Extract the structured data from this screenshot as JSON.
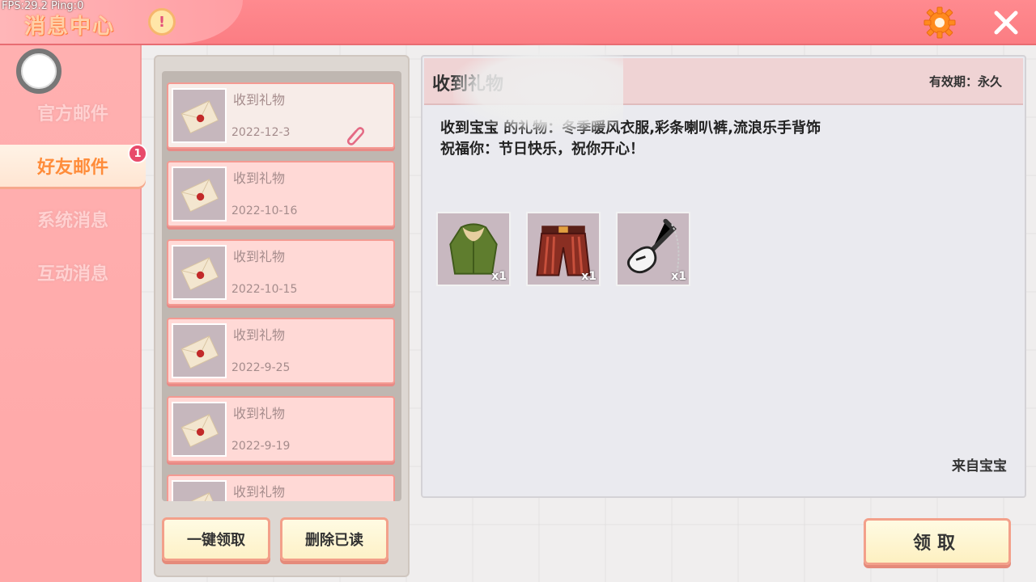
{
  "overlay": {
    "fps": "FPS:29.2  Ping:0"
  },
  "header": {
    "title": "消息中心",
    "alert_glyph": "!"
  },
  "sidebar": {
    "items": [
      {
        "label": "官方邮件"
      },
      {
        "label": "好友邮件",
        "badge": "1"
      },
      {
        "label": "系统消息"
      },
      {
        "label": "互动消息"
      }
    ]
  },
  "mail_list": {
    "items": [
      {
        "subject": "收到礼物",
        "date": "2022-12-3",
        "selected": true,
        "has_attachment": true
      },
      {
        "subject": "收到礼物",
        "date": "2022-10-16"
      },
      {
        "subject": "收到礼物",
        "date": "2022-10-15"
      },
      {
        "subject": "收到礼物",
        "date": "2022-9-25"
      },
      {
        "subject": "收到礼物",
        "date": "2022-9-19"
      },
      {
        "subject": "收到礼物",
        "date": ""
      }
    ],
    "claim_all_label": "一键领取",
    "delete_read_label": "删除已读"
  },
  "detail": {
    "title": "收到礼物",
    "validity": "有效期：永久",
    "body_line1": "收到宝宝                的礼物：冬季暖风衣服,彩条喇叭裤,流浪乐手背饰",
    "body_line2": "祝福你：节日快乐，祝你开心！",
    "rewards": [
      {
        "name": "green-jacket",
        "count": "x1"
      },
      {
        "name": "red-striped-pants",
        "count": "x1"
      },
      {
        "name": "electric-guitar",
        "count": "x1"
      }
    ],
    "sender": "来自宝宝",
    "claim_label": "领取"
  },
  "colors": {
    "accent": "#fb7d83",
    "active_tab_text": "#ff8c3a",
    "badge": "#e84a6a"
  }
}
